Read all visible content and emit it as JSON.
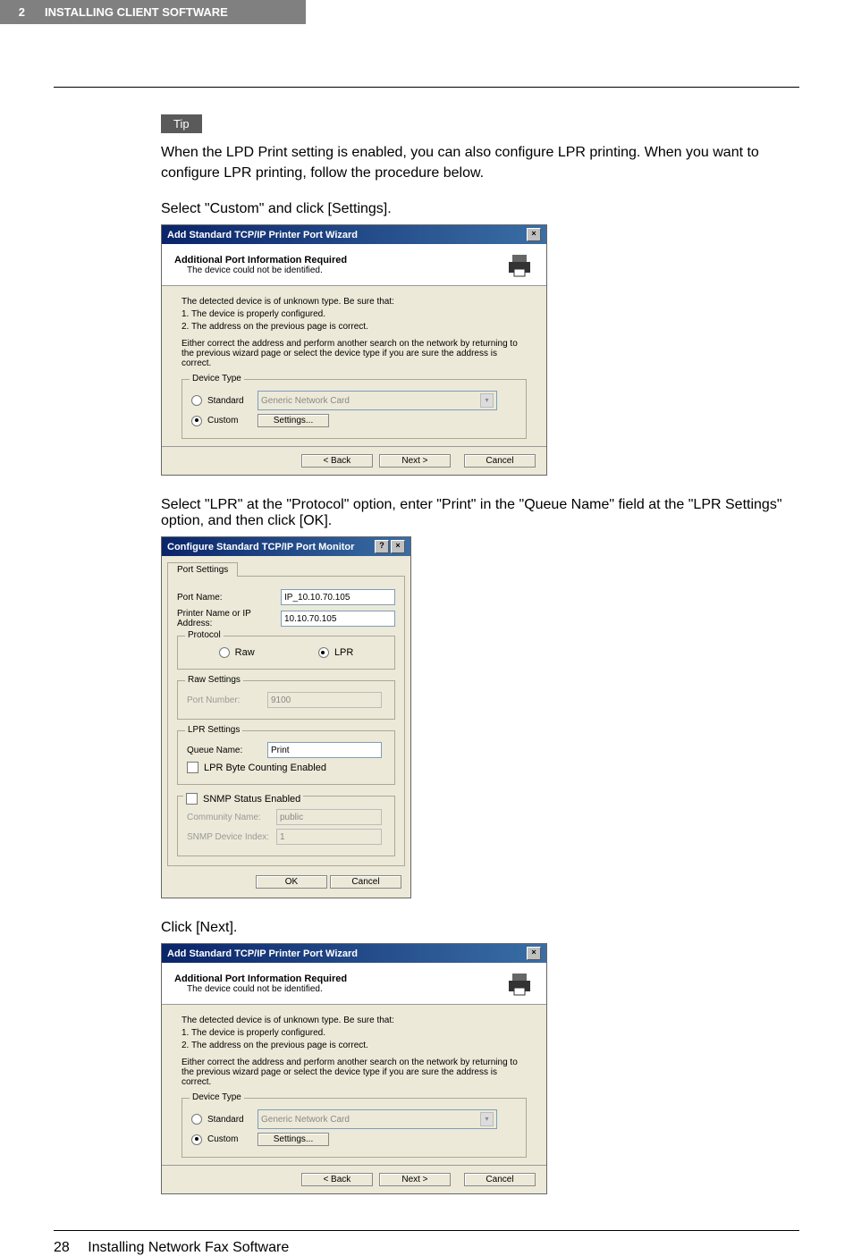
{
  "header": {
    "chapter_num": "2",
    "chapter_title": "INSTALLING CLIENT SOFTWARE"
  },
  "tip_label": "Tip",
  "para1": "When the LPD Print setting is enabled, you can also configure LPR printing. When you want to configure LPR printing, follow the procedure below.",
  "step1": "Select \"Custom\" and click [Settings].",
  "step2": "Select \"LPR\" at the \"Protocol\" option, enter \"Print\" in the \"Queue Name\" field at the \"LPR Settings\" option, and then click [OK].",
  "step3": "Click [Next].",
  "wizard": {
    "title": "Add Standard TCP/IP Printer Port Wizard",
    "close_x": "×",
    "head_title": "Additional Port Information Required",
    "head_sub": "The device could not be identified.",
    "body_intro": "The detected device is of unknown type. Be sure that:",
    "body_li1": "1. The device is properly configured.",
    "body_li2": "2. The address on the previous page is correct.",
    "body_para": "Either correct the address and perform another search on the network by returning to the previous wizard page or select the device type if you are sure the address is correct.",
    "group_label": "Device Type",
    "radio_standard": "Standard",
    "select_value": "Generic Network Card",
    "radio_custom": "Custom",
    "btn_settings": "Settings...",
    "btn_back": "< Back",
    "btn_next": "Next >",
    "btn_cancel": "Cancel"
  },
  "config": {
    "title": "Configure Standard TCP/IP Port Monitor",
    "help_q": "?",
    "close_x": "×",
    "tab": "Port Settings",
    "port_name_label": "Port Name:",
    "port_name_value": "IP_10.10.70.105",
    "ip_label": "Printer Name or IP Address:",
    "ip_value": "10.10.70.105",
    "protocol_label": "Protocol",
    "radio_raw": "Raw",
    "radio_lpr": "LPR",
    "raw_label": "Raw Settings",
    "port_number_label": "Port Number:",
    "port_number_value": "9100",
    "lpr_label": "LPR Settings",
    "queue_label": "Queue Name:",
    "queue_value": "Print",
    "lpr_byte": "LPR Byte Counting Enabled",
    "snmp_enabled": "SNMP Status Enabled",
    "community_label": "Community Name:",
    "community_value": "public",
    "device_idx_label": "SNMP Device Index:",
    "device_idx_value": "1",
    "btn_ok": "OK",
    "btn_cancel": "Cancel"
  },
  "footer": {
    "page_num": "28",
    "section": "Installing Network Fax Software"
  }
}
